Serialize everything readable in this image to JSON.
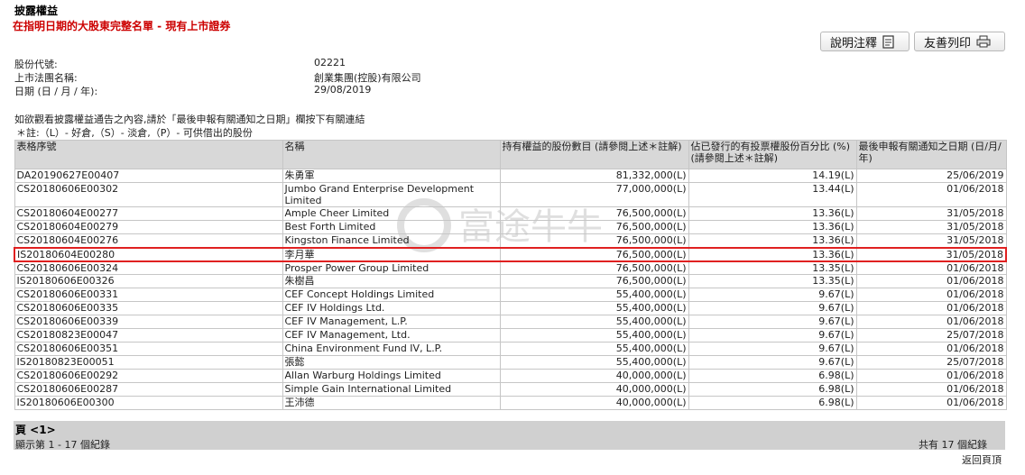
{
  "header": {
    "title": "披露權益",
    "subtitle": "在指明日期的大股東完整名單 - 現有上市證券"
  },
  "toolbar": {
    "notes_label": "說明注釋",
    "notes_icon": "document-icon",
    "print_label": "友善列印",
    "print_icon": "printer-icon"
  },
  "info": {
    "code_label": "股份代號:",
    "code_value": "02221",
    "name_label": "上市法團名稱:",
    "name_value": "創業集團(控股)有限公司",
    "date_label": "日期 (日 / 月 / 年):",
    "date_value": "29/08/2019"
  },
  "notes": {
    "line1": "如欲觀看披露權益通告之內容,請於「最後申報有關通知之日期」欄按下有關連結",
    "line2": "＊註:（L）- 好倉,（S）- 淡倉,（P）- 可供借出的股份"
  },
  "table": {
    "headers": [
      "表格序號",
      "名稱",
      "持有權益的股份數目 (請參閱上述＊註解)",
      "佔已發行的有投票權股份百分比 (%) (請參閱上述＊註解)",
      "最後申報有關通知之日期 (日/月/年)"
    ],
    "rows": [
      [
        "DA20190627E00407",
        "朱勇軍",
        "81,332,000(L)",
        "14.19(L)",
        "25/06/2019"
      ],
      [
        "CS20180606E00302",
        "Jumbo Grand Enterprise Development Limited",
        "77,000,000(L)",
        "13.44(L)",
        "01/06/2018"
      ],
      [
        "CS20180604E00277",
        "Ample Cheer Limited",
        "76,500,000(L)",
        "13.36(L)",
        "31/05/2018"
      ],
      [
        "CS20180604E00279",
        "Best Forth Limited",
        "76,500,000(L)",
        "13.36(L)",
        "31/05/2018"
      ],
      [
        "CS20180604E00276",
        "Kingston Finance Limited",
        "76,500,000(L)",
        "13.36(L)",
        "31/05/2018"
      ],
      [
        "IS20180604E00280",
        "李月華",
        "76,500,000(L)",
        "13.36(L)",
        "31/05/2018"
      ],
      [
        "CS20180606E00324",
        "Prosper Power Group Limited",
        "76,500,000(L)",
        "13.35(L)",
        "01/06/2018"
      ],
      [
        "IS20180606E00326",
        "朱樹昌",
        "76,500,000(L)",
        "13.35(L)",
        "01/06/2018"
      ],
      [
        "CS20180606E00331",
        "CEF Concept Holdings Limited",
        "55,400,000(L)",
        "9.67(L)",
        "01/06/2018"
      ],
      [
        "CS20180606E00335",
        "CEF IV Holdings Ltd.",
        "55,400,000(L)",
        "9.67(L)",
        "01/06/2018"
      ],
      [
        "CS20180606E00339",
        "CEF IV Management, L.P.",
        "55,400,000(L)",
        "9.67(L)",
        "01/06/2018"
      ],
      [
        "CS20180823E00047",
        "CEF IV Management, Ltd.",
        "55,400,000(L)",
        "9.67(L)",
        "25/07/2018"
      ],
      [
        "CS20180606E00351",
        "China Environment Fund IV, L.P.",
        "55,400,000(L)",
        "9.67(L)",
        "01/06/2018"
      ],
      [
        "IS20180823E00051",
        "張懿",
        "55,400,000(L)",
        "9.67(L)",
        "25/07/2018"
      ],
      [
        "CS20180606E00292",
        "Allan Warburg Holdings Limited",
        "40,000,000(L)",
        "6.98(L)",
        "01/06/2018"
      ],
      [
        "CS20180606E00287",
        "Simple Gain International Limited",
        "40,000,000(L)",
        "6.98(L)",
        "01/06/2018"
      ],
      [
        "IS20180606E00300",
        "王沛德",
        "40,000,000(L)",
        "6.98(L)",
        "01/06/2018"
      ]
    ],
    "highlight_row": 5,
    "highlight_color": "#e02020"
  },
  "footer": {
    "page": "頁 <1>",
    "showing": "顯示第 1 - 17 個紀錄",
    "total": "共有 17 個紀錄",
    "back_to_top": "返回頁頂"
  },
  "watermark": {
    "text": "富途牛牛"
  }
}
